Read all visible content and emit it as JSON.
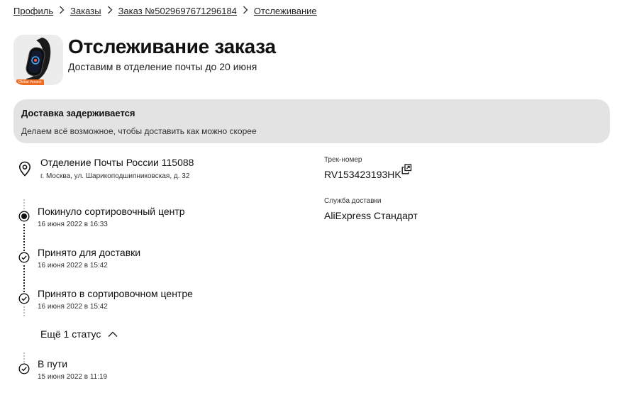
{
  "breadcrumbs": [
    "Профиль",
    "Заказы",
    "Заказ №5029697671296184",
    "Отслеживание"
  ],
  "product": {
    "badge": "Global Version"
  },
  "header": {
    "title": "Отслеживание заказа",
    "subtitle": "Доставим в отделение почты до 20 июня"
  },
  "alert": {
    "title": "Доставка задерживается",
    "text": "Делаем всё возможное, чтобы доставить как можно скорее"
  },
  "office": {
    "icon": "location-pin-icon",
    "name": "Отделение Почты России 115088",
    "address": "г. Москва, ул. Шарикоподшипниковская, д. 32"
  },
  "statuses": [
    {
      "title": "Покинуло сортировочный центр",
      "date": "16 июня 2022 в 16:33",
      "icon": "current-dot-icon"
    },
    {
      "title": "Принято для доставки",
      "date": "16 июня 2022 в 15:42",
      "icon": "check-circle-icon"
    },
    {
      "title": "Принято в сортировочном центре",
      "date": "16 июня 2022 в 15:42",
      "icon": "check-circle-icon"
    },
    {
      "title": "В пути",
      "date": "15 июня 2022 в 11:19",
      "icon": "check-circle-icon"
    }
  ],
  "more_statuses": {
    "label": "Ещё 1 статус",
    "icon": "chevron-up-icon"
  },
  "tracking": {
    "label": "Трек-номер",
    "number": "RV153423193HK",
    "copy_icon": "copy-icon"
  },
  "service": {
    "label": "Служба доставки",
    "name": "AliExpress Стандарт"
  }
}
